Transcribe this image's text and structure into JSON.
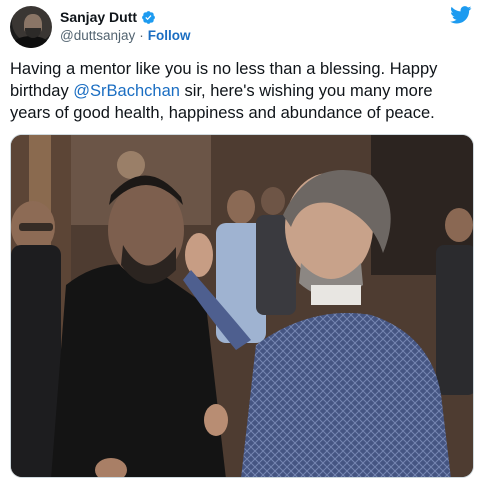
{
  "user": {
    "display_name": "Sanjay Dutt",
    "handle": "@duttsanjay",
    "separator": "·",
    "follow_label": "Follow"
  },
  "tweet": {
    "text_before_mention": "Having a mentor like you is no less than a blessing. Happy birthday ",
    "mention": "@SrBachchan",
    "text_after_mention": " sir, here's wishing you many more years of good health, happiness and abundance of peace."
  },
  "icons": {
    "verified": "verified-badge-icon",
    "brand": "twitter-bird-icon"
  },
  "colors": {
    "link": "#1b6ec2",
    "twitter_blue": "#1d9bf0",
    "secondary_text": "#536471"
  }
}
